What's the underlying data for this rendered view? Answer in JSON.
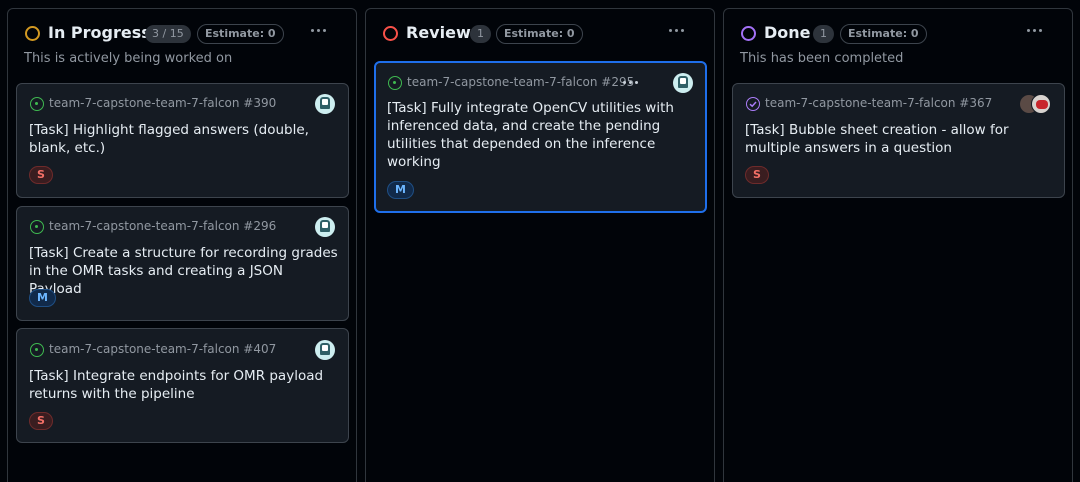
{
  "colors": {
    "in_progress": "#d29922",
    "review": "#f85149",
    "done": "#a371f7",
    "open_issue": "#3fb950",
    "closed_issue": "#ab7df8",
    "selected_border": "#1f6feb"
  },
  "columns": [
    {
      "title": "In Progress",
      "count": "3 / 15",
      "estimate": "Estimate: 0",
      "description": "This is actively being worked on",
      "cards": [
        {
          "repo": "team-7-capstone-team-7-falcon #390",
          "title": "[Task] Highlight flagged answers (double, blank, etc.)",
          "size": "S"
        },
        {
          "repo": "team-7-capstone-team-7-falcon #296",
          "title": "[Task] Create a structure for recording grades in the OMR tasks and creating a JSON Payload",
          "size": "M"
        },
        {
          "repo": "team-7-capstone-team-7-falcon #407",
          "title": "[Task] Integrate endpoints for OMR payload returns with the pipeline",
          "size": "S"
        }
      ]
    },
    {
      "title": "Review",
      "count": "1",
      "estimate": "Estimate: 0",
      "description": "",
      "cards": [
        {
          "repo": "team-7-capstone-team-7-falcon #295",
          "title": "[Task] Fully integrate OpenCV utilities with inferenced data, and create the pending utilities that depended on the inference working",
          "size": "M"
        }
      ]
    },
    {
      "title": "Done",
      "count": "1",
      "estimate": "Estimate: 0",
      "description": "This has been completed",
      "cards": [
        {
          "repo": "team-7-capstone-team-7-falcon #367",
          "title": "[Task] Bubble sheet creation - allow for multiple answers in a question",
          "size": "S"
        }
      ]
    }
  ]
}
